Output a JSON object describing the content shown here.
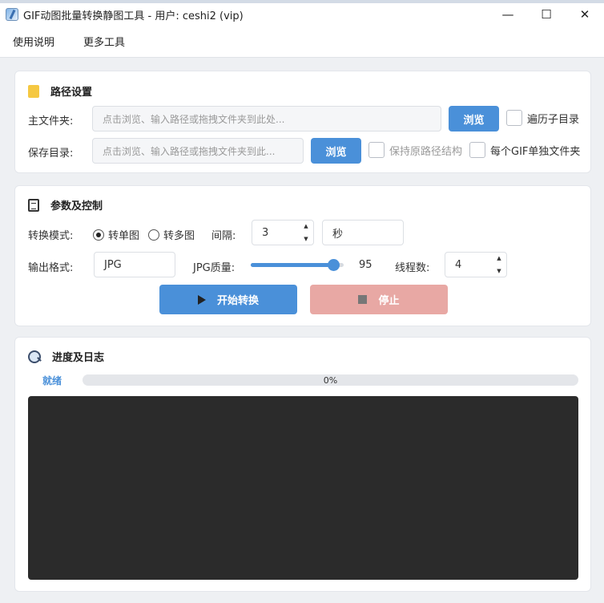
{
  "window": {
    "title": "GIF动图批量转换静图工具 - 用户: ceshi2 (vip)",
    "minimize": "—",
    "maximize": "☐",
    "close": "✕"
  },
  "menu": [
    "使用说明",
    "更多工具"
  ],
  "path_panel": {
    "title": "路径设置",
    "icon": "folder-icon",
    "main_folder_label": "主文件夹:",
    "main_folder_placeholder": "点击浏览、输入路径或拖拽文件夹到此处...",
    "main_folder_value": "",
    "browse_label": "浏览",
    "traverse_label": "遍历子目录",
    "traverse_checked": false,
    "save_dir_label": "保存目录:",
    "save_dir_placeholder": "点击浏览、输入路径或拖拽文件夹到此...",
    "save_dir_value": "",
    "browse2_label": "浏览",
    "keep_structure_label": "保持原路径结构",
    "keep_structure_checked": false,
    "per_gif_folder_label": "每个GIF单独文件夹",
    "per_gif_folder_checked": false
  },
  "control_panel": {
    "title": "参数及控制",
    "icon": "list-icon",
    "mode_label": "转换模式:",
    "mode_single": "转单图",
    "mode_multi": "转多图",
    "mode_selected": "single",
    "interval_label": "间隔:",
    "interval_value": "3",
    "interval_unit": "秒",
    "output_format_label": "输出格式:",
    "output_format_value": "JPG",
    "quality_label": "JPG质量:",
    "quality_value": "95",
    "quality_fraction": 0.89,
    "threads_label": "线程数:",
    "threads_value": "4",
    "start_label": "开始转换",
    "stop_label": "停止",
    "accent": "#4a90d9",
    "stop_color": "#e8a8a4"
  },
  "log_panel": {
    "title": "进度及日志",
    "icon": "search-document-icon",
    "status": "就绪",
    "progress_text": "0%",
    "progress_fraction": 0,
    "log_background": "#2b2b2b"
  }
}
